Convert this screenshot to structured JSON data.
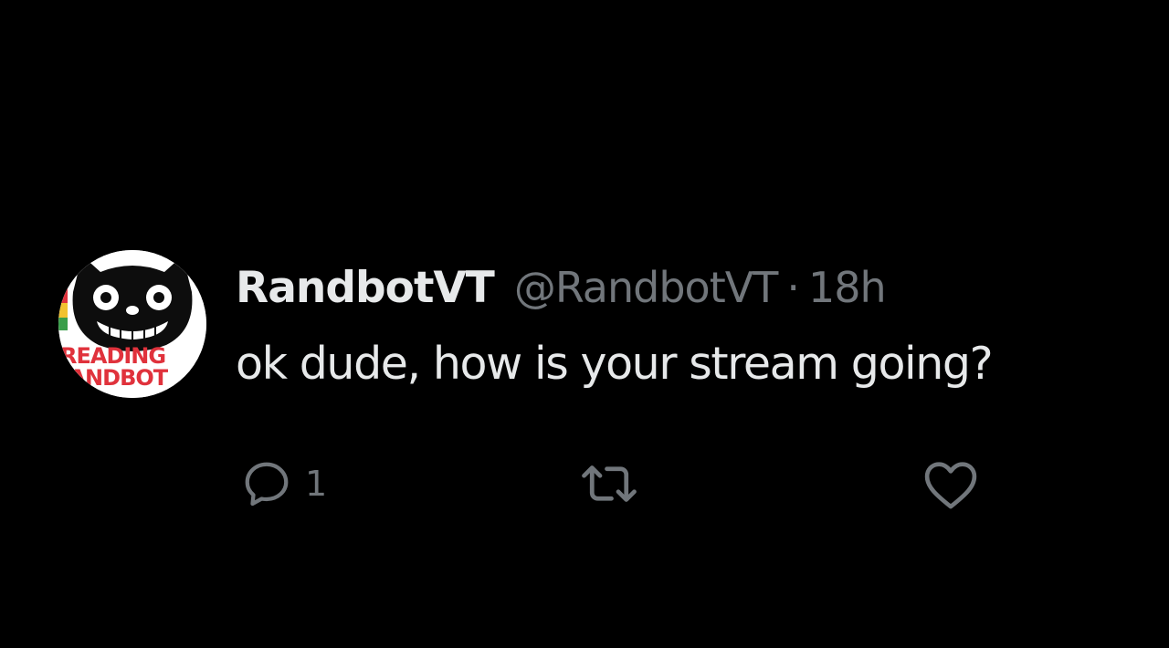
{
  "tweet": {
    "display_name": "RandbotVT",
    "handle": "@RandbotVT",
    "separator": "·",
    "time": "18h",
    "text": "ok dude, how is your stream going?",
    "avatar": {
      "icon": "reading-randbot-logo",
      "logo_text_line1": "READING",
      "logo_text_line2": "RANDBOT"
    },
    "actions": {
      "reply": {
        "icon": "reply-icon",
        "count": "1"
      },
      "retweet": {
        "icon": "retweet-icon",
        "count": ""
      },
      "like": {
        "icon": "heart-icon",
        "count": ""
      }
    }
  },
  "colors": {
    "background": "#000000",
    "primary_text": "#e7e9ea",
    "secondary_text": "#71767b",
    "logo_red": "#e0323c"
  }
}
